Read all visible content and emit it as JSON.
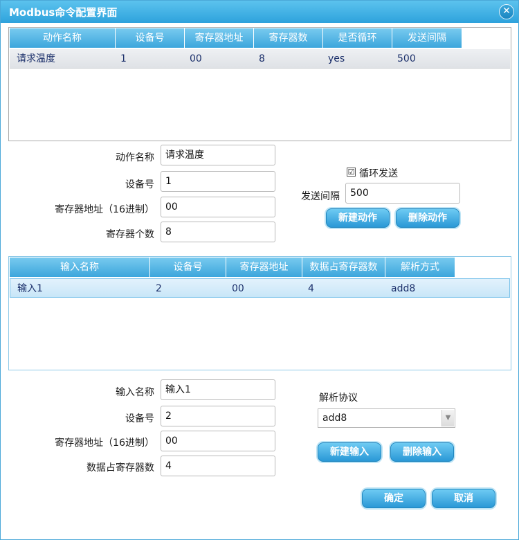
{
  "window": {
    "title": "Modbus命令配置界面",
    "close_glyph": "✕"
  },
  "actions_table": {
    "headers": [
      "动作名称",
      "设备号",
      "寄存器地址",
      "寄存器数",
      "是否循环",
      "发送间隔"
    ],
    "rows": [
      [
        "请求温度",
        "1",
        "00",
        "8",
        "yes",
        "500"
      ]
    ]
  },
  "action_form": {
    "name_label": "动作名称",
    "name_value": "请求温度",
    "device_label": "设备号",
    "device_value": "1",
    "address_label": "寄存器地址（16进制）",
    "address_value": "00",
    "count_label": "寄存器个数",
    "count_value": "8",
    "loop_check": "☑",
    "loop_label": "循环发送",
    "interval_label": "发送间隔",
    "interval_value": "500",
    "new_button": "新建动作",
    "delete_button": "删除动作"
  },
  "inputs_table": {
    "headers": [
      "输入名称",
      "设备号",
      "寄存器地址",
      "数据占寄存器数",
      "解析方式"
    ],
    "rows": [
      [
        "输入1",
        "2",
        "00",
        "4",
        "add8"
      ]
    ]
  },
  "input_form": {
    "name_label": "输入名称",
    "name_value": "输入1",
    "device_label": "设备号",
    "device_value": "2",
    "address_label": "寄存器地址（16进制）",
    "address_value": "00",
    "count_label": "数据占寄存器数",
    "count_value": "4",
    "protocol_label": "解析协议",
    "protocol_value": "add8",
    "new_button": "新建输入",
    "delete_button": "删除输入"
  },
  "footer": {
    "ok_button": "确定",
    "cancel_button": "取消"
  },
  "colors": {
    "accent": "#3ca6dc",
    "row_selected": "#dce7f4",
    "row_text": "#1b2f6a"
  }
}
